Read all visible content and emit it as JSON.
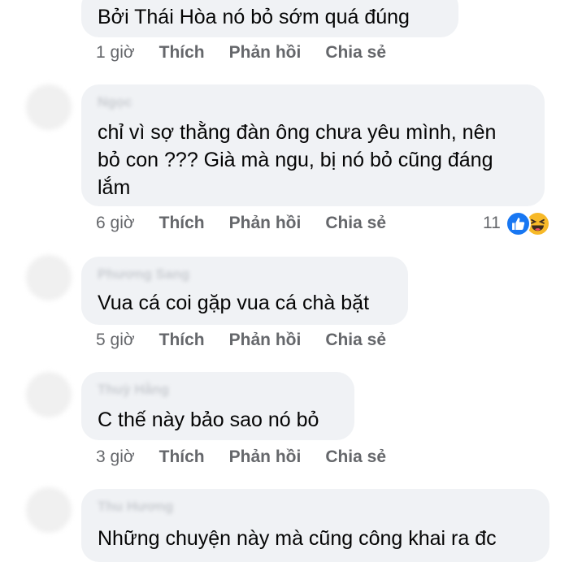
{
  "comments": [
    {
      "text_lines": [
        "Bởi Thái Hòa nó bỏ sớm quá đúng"
      ],
      "time": "1 giờ",
      "like": "Thích",
      "reply": "Phản hồi",
      "share": "Chia sẻ"
    },
    {
      "author": "Ngọc",
      "text_lines": [
        "chỉ vì sợ thằng đàn ông chưa yêu mình, nên",
        "bỏ con ???  Già mà ngu, bị nó bỏ cũng đáng",
        "lắm"
      ],
      "time": "6 giờ",
      "like": "Thích",
      "reply": "Phản hồi",
      "share": "Chia sẻ",
      "reaction_count": "11",
      "reaction_icons": [
        "like-icon",
        "haha-icon"
      ]
    },
    {
      "author": "Phương Sang",
      "text_lines": [
        "Vua cá coi gặp vua cá chà bặt"
      ],
      "time": "5 giờ",
      "like": "Thích",
      "reply": "Phản hồi",
      "share": "Chia sẻ"
    },
    {
      "author": "Thuỳ Hằng",
      "text_lines": [
        "C thế này bảo sao nó bỏ"
      ],
      "time": "3 giờ",
      "like": "Thích",
      "reply": "Phản hồi",
      "share": "Chia sẻ"
    },
    {
      "author": "Thu Hương",
      "text_lines": [
        "Những chuyện này mà cũng công khai ra đc"
      ]
    }
  ],
  "colors": {
    "bubble": "#f0f2f5",
    "meta": "#65676b",
    "like": "#1877f2",
    "haha": "#f7b928"
  }
}
